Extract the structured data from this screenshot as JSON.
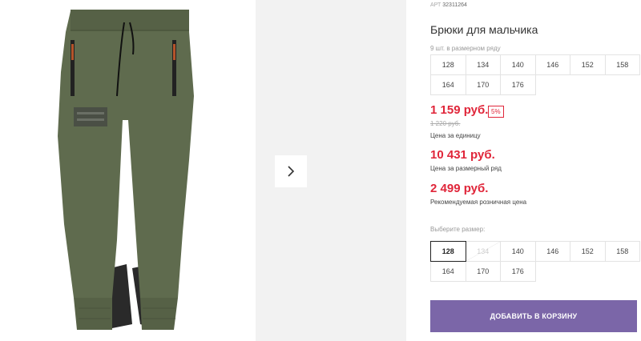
{
  "product": {
    "article_label": "АРТ",
    "article_number": "32311264",
    "title": "Брюки для мальчика",
    "size_count": "9 шт. в размерном ряду",
    "sizes_row": [
      "128",
      "134",
      "140",
      "146",
      "152",
      "158",
      "164",
      "170",
      "176"
    ],
    "price": "1 159 руб.",
    "discount": "5%",
    "old_price": "1 220 руб.",
    "unit_price_label": "Цена за единицу",
    "set_price": "10 431 руб.",
    "set_price_label": "Цена за размерный ряд",
    "retail_price": "2 499 руб.",
    "retail_price_label": "Рекомендуемая розничная цена",
    "choose_size_label": "Выберите размер:",
    "size_options": [
      {
        "label": "128",
        "state": "selected"
      },
      {
        "label": "134",
        "state": "disabled"
      },
      {
        "label": "140",
        "state": "available"
      },
      {
        "label": "146",
        "state": "available"
      },
      {
        "label": "152",
        "state": "available"
      },
      {
        "label": "158",
        "state": "available"
      },
      {
        "label": "164",
        "state": "available"
      },
      {
        "label": "170",
        "state": "available"
      },
      {
        "label": "176",
        "state": "available"
      }
    ],
    "add_to_cart": "ДОБАВИТЬ В КОРЗИНУ"
  },
  "colors": {
    "price": "#e0263a",
    "button": "#7b66a8",
    "pants_main": "#5f6b4e",
    "pants_accent": "#2a2a2a"
  },
  "icons": {
    "next": "chevron-right-icon"
  }
}
